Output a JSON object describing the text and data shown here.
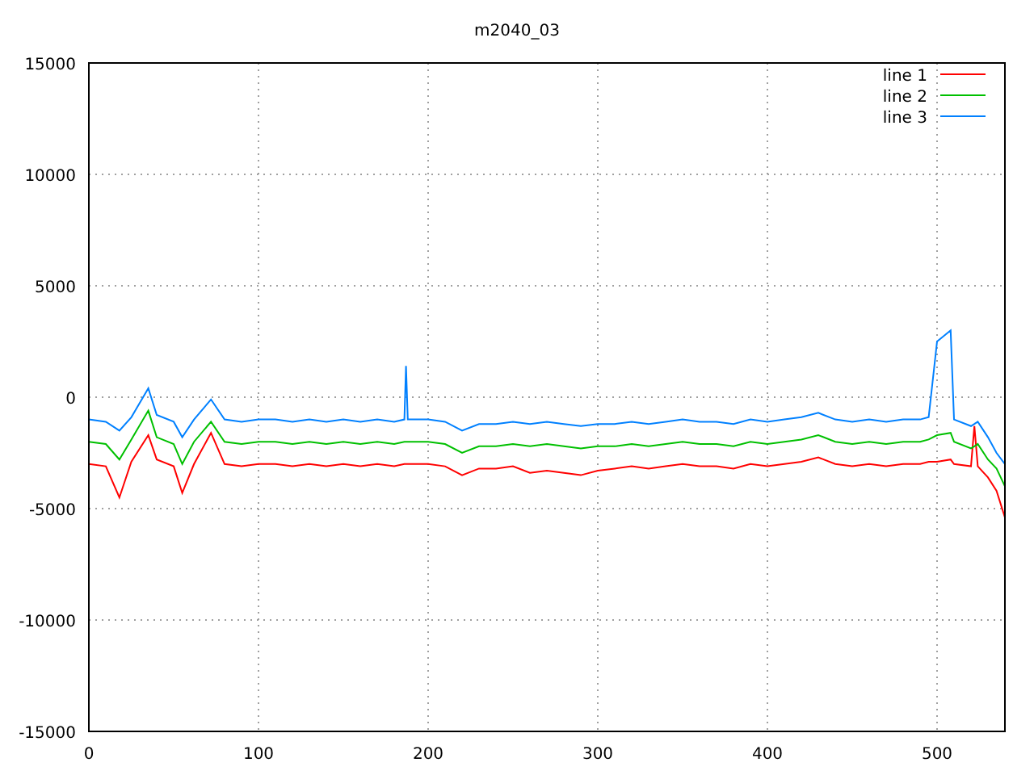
{
  "chart_data": {
    "type": "line",
    "title": "m2040_03",
    "grid": true,
    "legend": true,
    "xlim": [
      0,
      540
    ],
    "ylim": [
      -15000,
      15000
    ],
    "xticks": [
      0,
      100,
      200,
      300,
      400,
      500
    ],
    "yticks": [
      -15000,
      -10000,
      -5000,
      0,
      5000,
      10000,
      15000
    ],
    "x": [
      0,
      10,
      18,
      25,
      35,
      40,
      50,
      55,
      62,
      72,
      80,
      90,
      100,
      110,
      120,
      130,
      140,
      150,
      160,
      170,
      180,
      186,
      187,
      188,
      200,
      210,
      220,
      230,
      240,
      250,
      260,
      270,
      280,
      290,
      300,
      310,
      320,
      330,
      340,
      350,
      360,
      370,
      380,
      390,
      400,
      410,
      420,
      430,
      440,
      450,
      460,
      470,
      480,
      490,
      495,
      500,
      508,
      510,
      520,
      522,
      524,
      530,
      535,
      540
    ],
    "series": [
      {
        "name": "line 1",
        "color": "#ff0000",
        "values": [
          -3000,
          -3100,
          -4500,
          -2900,
          -1700,
          -2800,
          -3100,
          -4300,
          -3000,
          -1600,
          -3000,
          -3100,
          -3000,
          -3000,
          -3100,
          -3000,
          -3100,
          -3000,
          -3100,
          -3000,
          -3100,
          -3000,
          -3000,
          -3000,
          -3000,
          -3100,
          -3500,
          -3200,
          -3200,
          -3100,
          -3400,
          -3300,
          -3400,
          -3500,
          -3300,
          -3200,
          -3100,
          -3200,
          -3100,
          -3000,
          -3100,
          -3100,
          -3200,
          -3000,
          -3100,
          -3000,
          -2900,
          -2700,
          -3000,
          -3100,
          -3000,
          -3100,
          -3000,
          -3000,
          -2900,
          -2900,
          -2800,
          -3000,
          -3100,
          -1300,
          -3100,
          -3600,
          -4200,
          -5400
        ]
      },
      {
        "name": "line 2",
        "color": "#00c000",
        "values": [
          -2000,
          -2100,
          -2800,
          -1900,
          -600,
          -1800,
          -2100,
          -3000,
          -2000,
          -1100,
          -2000,
          -2100,
          -2000,
          -2000,
          -2100,
          -2000,
          -2100,
          -2000,
          -2100,
          -2000,
          -2100,
          -2000,
          -2000,
          -2000,
          -2000,
          -2100,
          -2500,
          -2200,
          -2200,
          -2100,
          -2200,
          -2100,
          -2200,
          -2300,
          -2200,
          -2200,
          -2100,
          -2200,
          -2100,
          -2000,
          -2100,
          -2100,
          -2200,
          -2000,
          -2100,
          -2000,
          -1900,
          -1700,
          -2000,
          -2100,
          -2000,
          -2100,
          -2000,
          -2000,
          -1900,
          -1700,
          -1600,
          -2000,
          -2300,
          -2200,
          -2100,
          -2800,
          -3200,
          -4000
        ]
      },
      {
        "name": "line 3",
        "color": "#0080ff",
        "values": [
          -1000,
          -1100,
          -1500,
          -900,
          400,
          -800,
          -1100,
          -1800,
          -1000,
          -100,
          -1000,
          -1100,
          -1000,
          -1000,
          -1100,
          -1000,
          -1100,
          -1000,
          -1100,
          -1000,
          -1100,
          -1000,
          1400,
          -1000,
          -1000,
          -1100,
          -1500,
          -1200,
          -1200,
          -1100,
          -1200,
          -1100,
          -1200,
          -1300,
          -1200,
          -1200,
          -1100,
          -1200,
          -1100,
          -1000,
          -1100,
          -1100,
          -1200,
          -1000,
          -1100,
          -1000,
          -900,
          -700,
          -1000,
          -1100,
          -1000,
          -1100,
          -1000,
          -1000,
          -900,
          2500,
          3000,
          -1000,
          -1300,
          -1200,
          -1100,
          -1800,
          -2500,
          -3000
        ]
      }
    ]
  }
}
